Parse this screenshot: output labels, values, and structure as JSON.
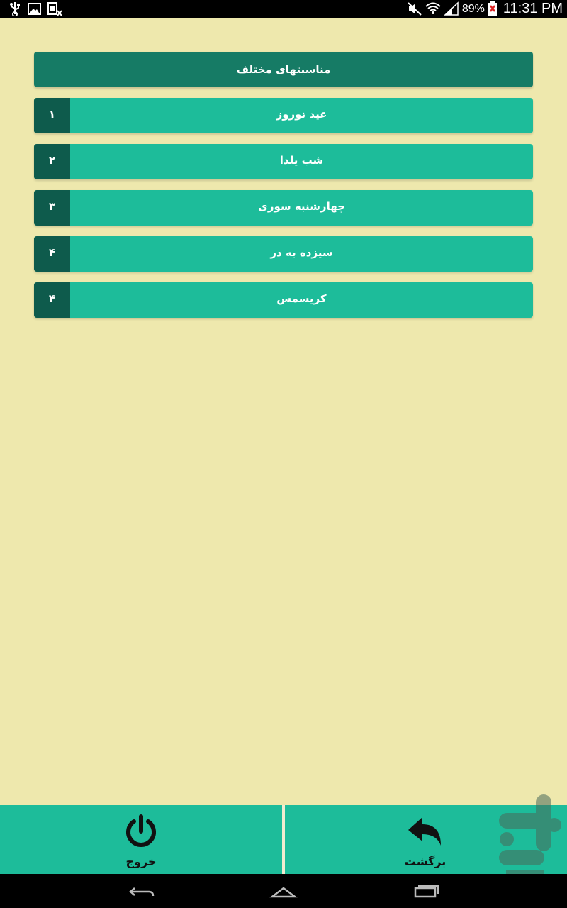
{
  "status_bar": {
    "battery": "89%",
    "time": "11:31 PM"
  },
  "list": {
    "header": "مناسبتهای مختلف",
    "items": [
      {
        "number": "۱",
        "label": "عید نوروز"
      },
      {
        "number": "۲",
        "label": "شب یلدا"
      },
      {
        "number": "۳",
        "label": "چهارشنبه سوری"
      },
      {
        "number": "۴",
        "label": "سیزده به در"
      },
      {
        "number": "۴",
        "label": "کریسمس"
      }
    ]
  },
  "bottom_bar": {
    "exit_label": "خروج",
    "back_label": "برگشت",
    "exit_icon": "power-icon",
    "back_icon": "reply-arrow-icon"
  },
  "colors": {
    "background": "#eee8ad",
    "header": "#167b65",
    "item": "#1dbc9a",
    "number_cell": "#0e5b4c"
  }
}
